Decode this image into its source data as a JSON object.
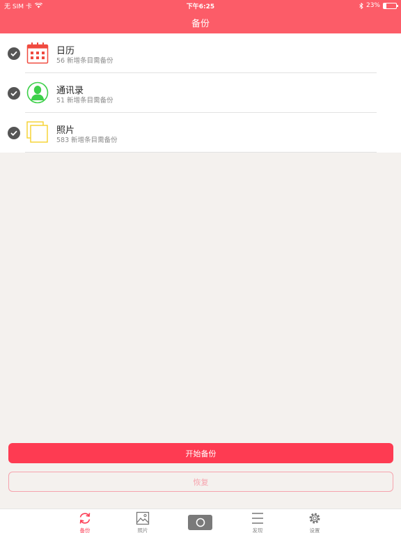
{
  "status_bar": {
    "carrier": "无 SIM 卡",
    "time": "下午6:25",
    "battery_percent": "23%",
    "battery_level": 0.23
  },
  "nav": {
    "title": "备份"
  },
  "items": [
    {
      "title": "日历",
      "subtitle": "56 新增条目需备份",
      "icon": "calendar-icon",
      "color": "#f04a3f"
    },
    {
      "title": "通讯录",
      "subtitle": "51 新增条目需备份",
      "icon": "contact-icon",
      "color": "#3dd04a"
    },
    {
      "title": "照片",
      "subtitle": "583 新增条目需备份",
      "icon": "photos-icon",
      "color": "#f5d12b"
    }
  ],
  "buttons": {
    "start": "开始备份",
    "restore": "恢复"
  },
  "tabs": [
    {
      "label": "备份",
      "icon": "sync-icon",
      "active": true
    },
    {
      "label": "照片",
      "icon": "image-icon",
      "active": false
    },
    {
      "label": "",
      "icon": "camera-icon",
      "active": false
    },
    {
      "label": "发现",
      "icon": "list-icon",
      "active": false
    },
    {
      "label": "设置",
      "icon": "gear-icon",
      "active": false
    }
  ],
  "colors": {
    "accent": "#fc5c68",
    "primary_button": "#fe3b52",
    "background": "#f4f1ee"
  }
}
